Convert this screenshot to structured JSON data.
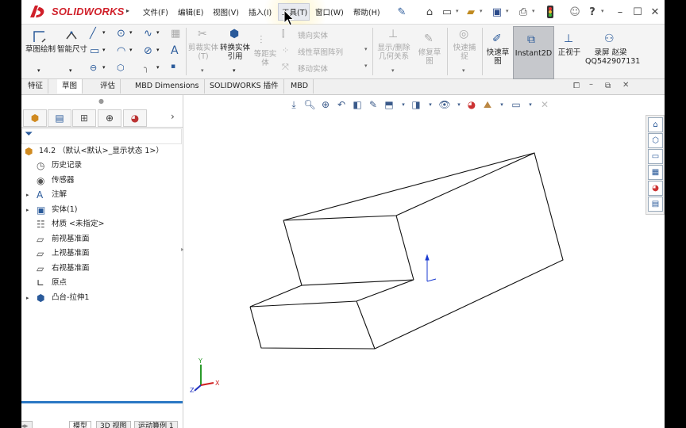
{
  "app": {
    "logo_text": "SOLIDWORKS"
  },
  "menu": [
    {
      "id": "file",
      "label": "文件(F)"
    },
    {
      "id": "edit",
      "label": "编辑(E)"
    },
    {
      "id": "view",
      "label": "视图(V)"
    },
    {
      "id": "insert",
      "label": "插入(I)"
    },
    {
      "id": "tools",
      "label": "工具(T)"
    },
    {
      "id": "window",
      "label": "窗口(W)"
    },
    {
      "id": "help",
      "label": "帮助(H)"
    }
  ],
  "command_manager": {
    "sketch": "草图绘制",
    "smart_dimension": "智能尺寸",
    "trim": "剪裁实体(T)",
    "convert": "转换实体引用",
    "offset": "等距实体",
    "mirror": "镜向实体",
    "linear_pattern": "线性草图阵列",
    "move": "移动实体",
    "relations": "显示/删除几何关系",
    "repair": "修复草图",
    "quick_snaps": "快速捕捉",
    "rapid_sketch": "快速草图",
    "instant2d": "Instant2D",
    "normal_to": "正视于",
    "recorder_line1": "录屏 赵梁",
    "recorder_line2": "QQ542907131"
  },
  "tabs": [
    "特征",
    "草图",
    "评估",
    "MBD Dimensions",
    "SOLIDWORKS 插件",
    "MBD"
  ],
  "active_tab": "草图",
  "tree": {
    "root": "14.2 （默认<默认>_显示状态 1>）",
    "items": [
      {
        "label": "历史记录",
        "icon": "history-icon",
        "expand": false
      },
      {
        "label": "传感器",
        "icon": "sensor-icon",
        "expand": false
      },
      {
        "label": "注解",
        "icon": "annotation-icon",
        "expand": true
      },
      {
        "label": "实体(1)",
        "icon": "solid-body-icon",
        "expand": true
      },
      {
        "label": "材质 <未指定>",
        "icon": "material-icon",
        "expand": false
      },
      {
        "label": "前视基准面",
        "icon": "plane-icon",
        "expand": false
      },
      {
        "label": "上视基准面",
        "icon": "plane-icon",
        "expand": false
      },
      {
        "label": "右视基准面",
        "icon": "plane-icon",
        "expand": false
      },
      {
        "label": "原点",
        "icon": "origin-icon",
        "expand": false
      },
      {
        "label": "凸台-拉伸1",
        "icon": "extrude-icon",
        "expand": true
      }
    ]
  },
  "bottom_tabs": [
    "模型",
    "3D 视图",
    "运动算例 1"
  ],
  "triad": {
    "y": "Y",
    "x": "X",
    "z": "Z"
  },
  "colors": {
    "accent": "#2b78c4",
    "logo_red": "#d0202a",
    "highlight": "#c6c8cc"
  }
}
